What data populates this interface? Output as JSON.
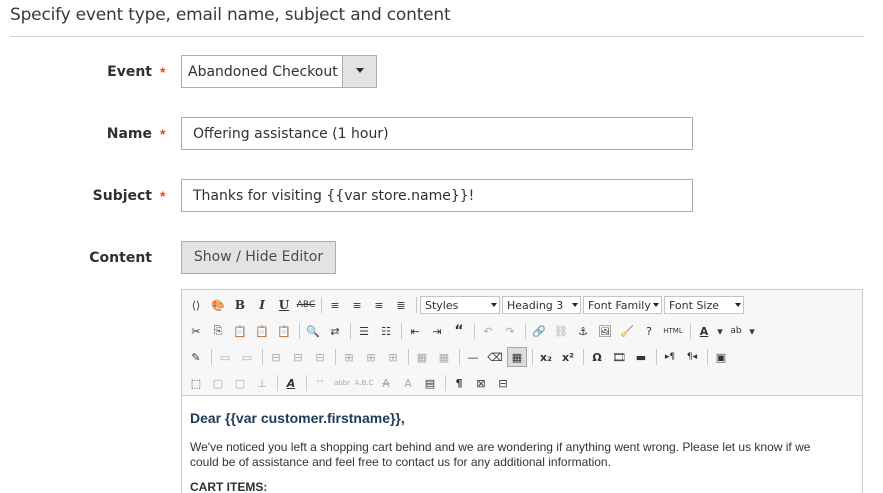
{
  "section": {
    "title": "Specify event type, email name, subject and content"
  },
  "fields": {
    "event": {
      "label": "Event",
      "required_mark": "*",
      "value": "Abandoned Checkout"
    },
    "name": {
      "label": "Name",
      "required_mark": "*",
      "value": "Offering assistance (1 hour)"
    },
    "subject": {
      "label": "Subject",
      "required_mark": "*",
      "value": "Thanks for visiting {{var store.name}}!"
    },
    "content": {
      "label": "Content",
      "toggle_label": "Show / Hide Editor"
    }
  },
  "editor": {
    "toolbar": {
      "styles": "Styles",
      "heading": "Heading 3",
      "font_family": "Font Family",
      "font_size": "Font Size",
      "html_label": "HTML"
    },
    "body": {
      "greeting": "Dear {{var customer.firstname}},",
      "paragraph": "We've noticed you left a shopping cart behind and we are wondering if anything went wrong. Please let us know if we could be of assistance and feel free to contact us for any additional information.",
      "cart_title": "CART ITEMS:"
    }
  },
  "colors": {
    "required": "#eb5202",
    "greeting": "#1e3a5a",
    "button_bg": "#e3e3e3"
  }
}
